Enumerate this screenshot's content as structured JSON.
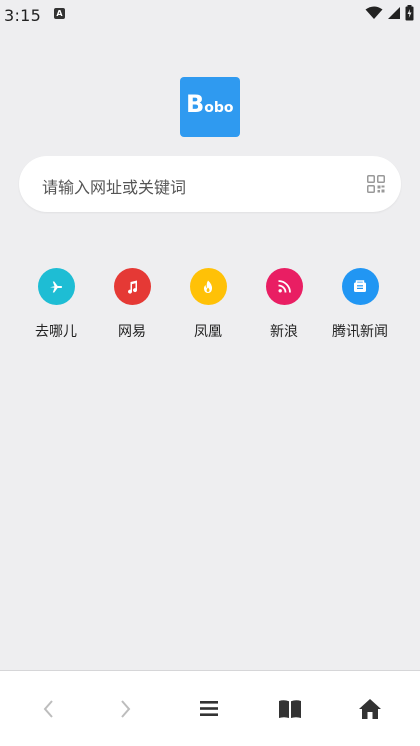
{
  "status_bar": {
    "time": "3:15",
    "notification_icon": "A"
  },
  "logo": {
    "text_big": "B",
    "text_small": "obo",
    "color": "#2f9af0"
  },
  "search": {
    "placeholder": "请输入网址或关键词"
  },
  "shortcuts": [
    {
      "label": "去哪儿",
      "icon": "airplane-icon",
      "color": "#1ebdd4"
    },
    {
      "label": "网易",
      "icon": "music-note-icon",
      "color": "#e53935"
    },
    {
      "label": "凤凰",
      "icon": "flame-icon",
      "color": "#ffc107"
    },
    {
      "label": "新浪",
      "icon": "rss-icon",
      "color": "#e91e63"
    },
    {
      "label": "腾讯新闻",
      "icon": "news-icon",
      "color": "#2196f3"
    }
  ],
  "bottom_nav": {
    "items": [
      "back-icon",
      "forward-icon",
      "menu-icon",
      "bookmarks-icon",
      "home-icon"
    ]
  }
}
